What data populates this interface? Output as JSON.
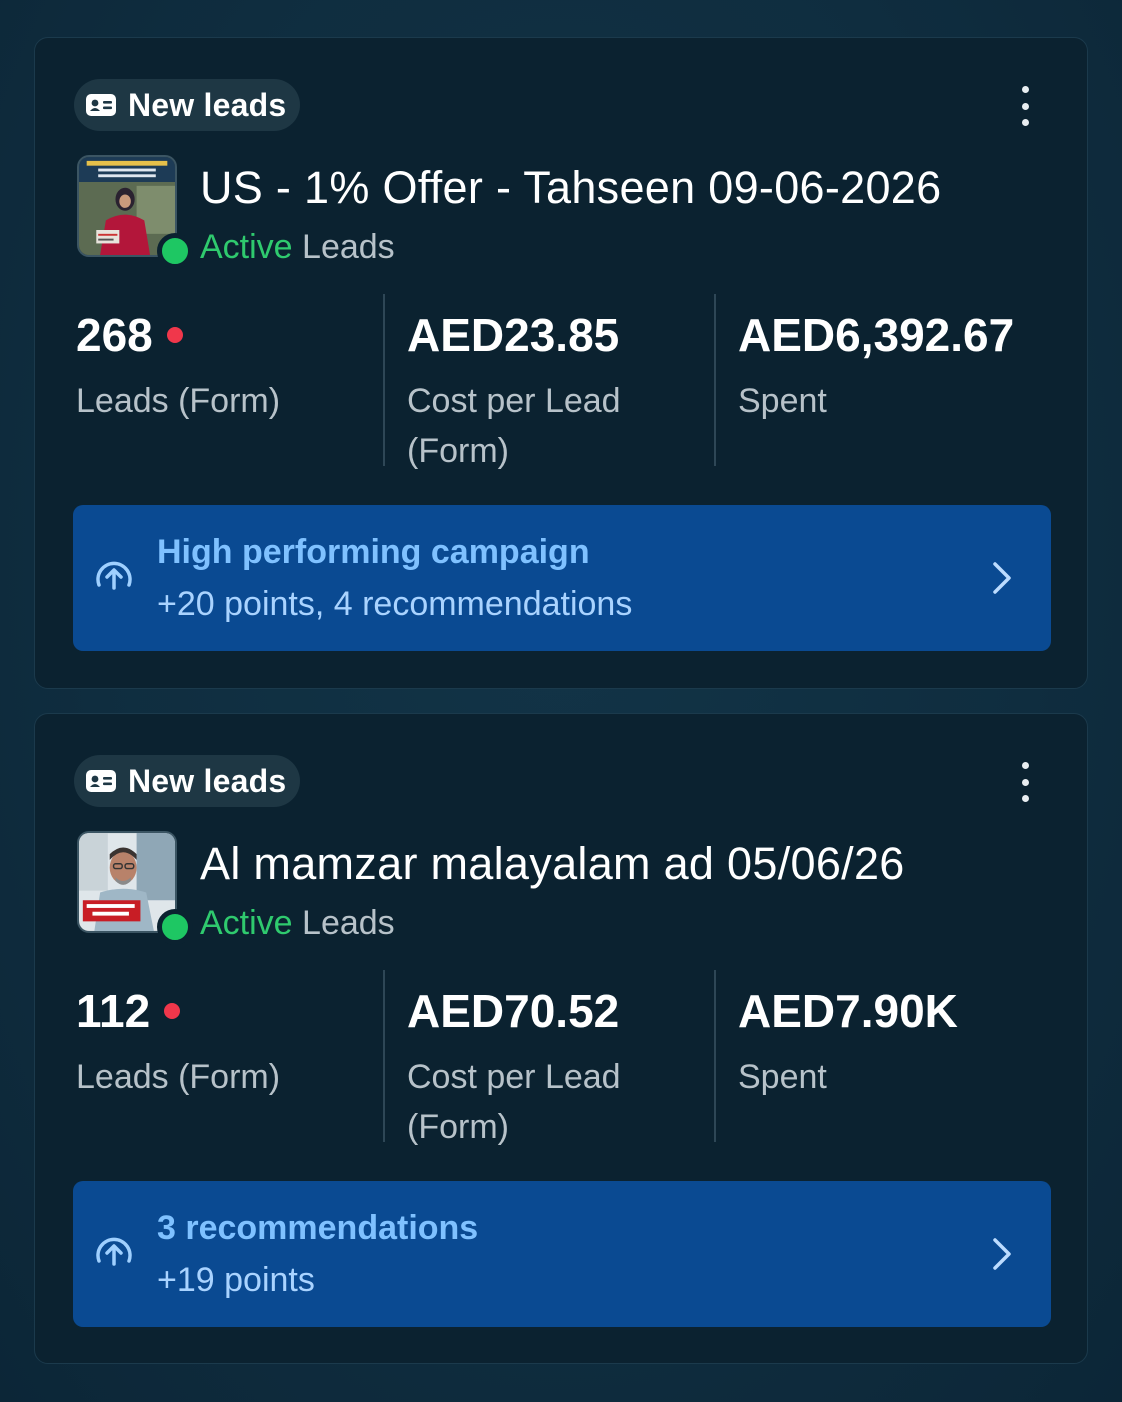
{
  "campaigns": [
    {
      "chip_label": "New leads",
      "title": "US - 1% Offer - Tahseen 09-06-2026",
      "status": "Active",
      "objective": "Leads",
      "metrics": [
        {
          "value": "268",
          "label": "Leads (Form)",
          "has_alert_dot": true
        },
        {
          "value": "AED23.85",
          "label": "Cost per Lead (Form)"
        },
        {
          "value": "AED6,392.67",
          "label": "Spent"
        }
      ],
      "banner": {
        "line1": "High performing campaign",
        "line2": "+20 points, 4 recommendations"
      },
      "thumbnail_icon": "campaign-thumbnail-woman-icon"
    },
    {
      "chip_label": "New leads",
      "title": "Al mamzar malayalam ad 05/06/26",
      "status": "Active",
      "objective": "Leads",
      "metrics": [
        {
          "value": "112",
          "label": "Leads (Form)",
          "has_alert_dot": true
        },
        {
          "value": "AED70.52",
          "label": "Cost per Lead (Form)"
        },
        {
          "value": "AED7.90K",
          "label": "Spent"
        }
      ],
      "banner": {
        "line1": "3 recommendations",
        "line2": "+19 points"
      },
      "thumbnail_icon": "campaign-thumbnail-man-icon"
    }
  ],
  "colors": {
    "background": "#0f2e40",
    "card": "#0b2230",
    "active_green": "#2fca6e",
    "alert_red": "#f0374b",
    "banner_blue": "#0a4a92",
    "banner_text": "#7fc1ff"
  }
}
